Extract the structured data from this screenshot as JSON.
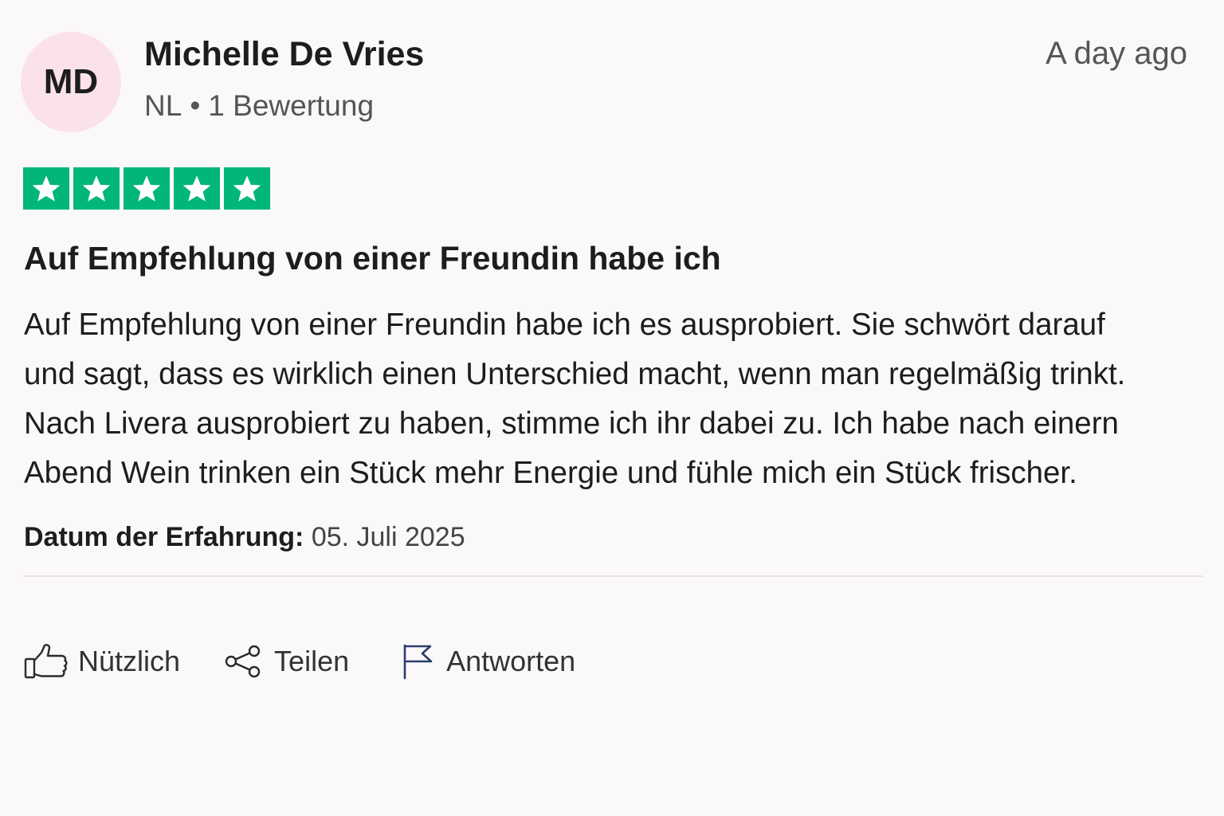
{
  "reviewer": {
    "initials": "MD",
    "name": "Michelle De Vries",
    "country": "NL",
    "separator": "•",
    "review_count": "1 Bewertung"
  },
  "timestamp": "A day ago",
  "rating": {
    "stars": 5,
    "max": 5,
    "color": "#00b67a"
  },
  "review": {
    "title": "Auf Empfehlung von einer Freundin habe ich",
    "body_lines": [
      "Auf Empfehlung von einer Freundin habe ich es ausprobiert. Sie schwört darauf",
      "und sagt, dass es wirklich einen Unterschied macht, wenn man regelmäßig trinkt.",
      "Nach Livera ausprobiert zu haben, stimme ich ihr dabei zu. Ich habe nach einern",
      "Abend Wein trinken ein Stück mehr Energie und fühle mich ein Stück frischer."
    ]
  },
  "experience": {
    "label": "Datum der Erfahrung:",
    "date": "05. Juli 2025"
  },
  "actions": {
    "useful": {
      "label": "Nützlich",
      "icon": "thumbs-up-icon"
    },
    "share": {
      "label": "Teilen",
      "icon": "share-icon"
    },
    "reply": {
      "label": "Antworten",
      "icon": "flag-icon"
    }
  },
  "colors": {
    "background": "#fbf8fa",
    "avatar_bg": "#fbe2e8",
    "star_green": "#00b67a",
    "flag_blue": "#2c3e6b"
  }
}
